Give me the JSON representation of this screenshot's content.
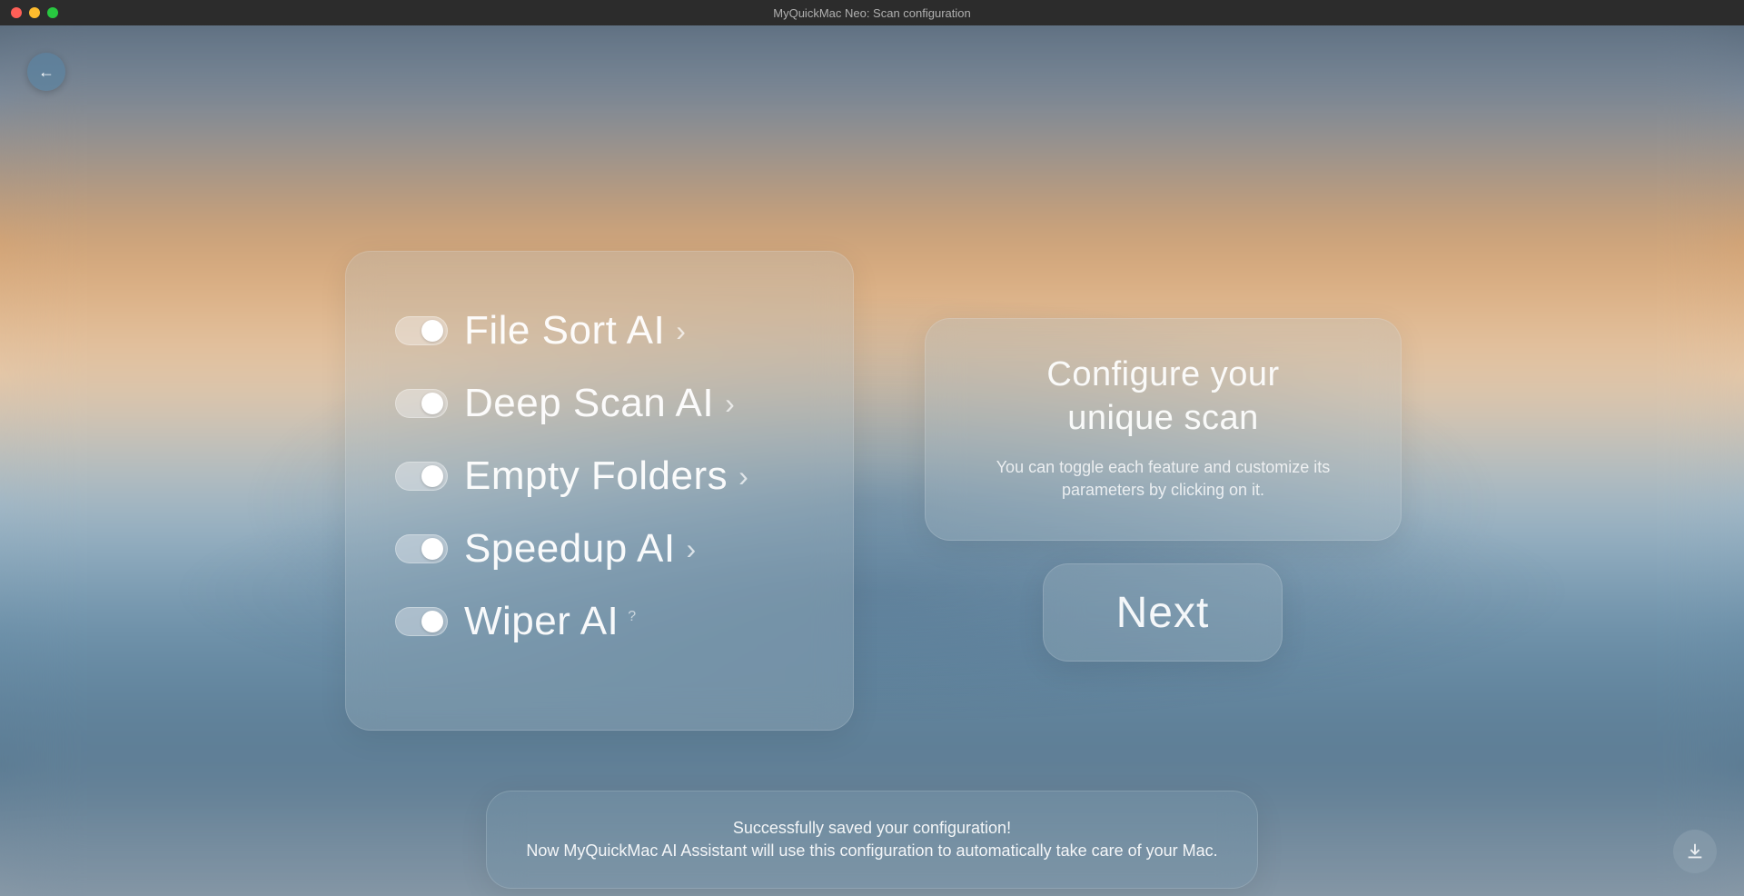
{
  "window": {
    "title": "MyQuickMac Neo: Scan configuration"
  },
  "features": [
    {
      "label": "File Sort AI",
      "enabled": true,
      "has_chevron": true
    },
    {
      "label": "Deep Scan AI",
      "enabled": true,
      "has_chevron": true
    },
    {
      "label": "Empty Folders",
      "enabled": true,
      "has_chevron": true
    },
    {
      "label": "Speedup AI",
      "enabled": true,
      "has_chevron": true
    },
    {
      "label": "Wiper AI",
      "enabled": true,
      "has_qmark": true
    }
  ],
  "info": {
    "title_line1": "Configure your",
    "title_line2": "unique scan",
    "description": "You can toggle each feature and customize its parameters by clicking on it."
  },
  "next_button": {
    "label": "Next"
  },
  "toast": {
    "line1": "Successfully saved your configuration!",
    "line2": "Now MyQuickMac AI Assistant will use this configuration to automatically take care of your Mac."
  },
  "icons": {
    "back_arrow": "←",
    "chevron": "›",
    "question": "?"
  }
}
